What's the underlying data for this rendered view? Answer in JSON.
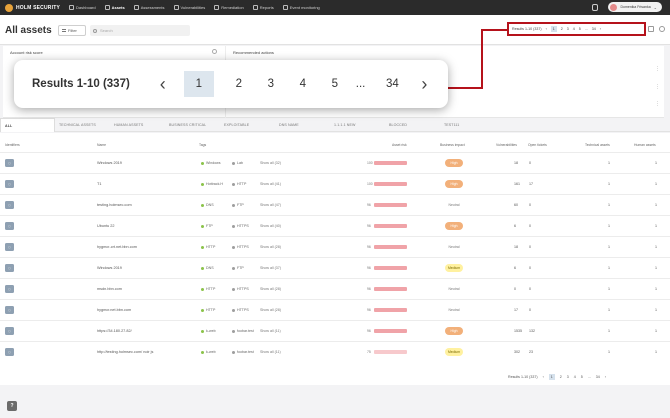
{
  "app": {
    "logo": "HOLM SECURITY",
    "user": "Domenika Frisanka"
  },
  "nav": {
    "items": [
      {
        "label": "Dashboard",
        "active": false
      },
      {
        "label": "Assets",
        "active": true
      },
      {
        "label": "Assessments",
        "active": false
      },
      {
        "label": "Vulnerabilities",
        "active": false
      },
      {
        "label": "Remediation",
        "active": false
      },
      {
        "label": "Reports",
        "active": false
      },
      {
        "label": "Event monitoring",
        "active": false
      }
    ]
  },
  "header": {
    "title": "All assets",
    "filter": "Filter",
    "search_placeholder": "Search"
  },
  "pagination": {
    "results": "Results 1-10 (337)",
    "pages": [
      "1",
      "2",
      "3",
      "4",
      "5",
      "...",
      "34"
    ],
    "prev": "‹",
    "next": "›"
  },
  "cards": {
    "left_title": "Account risk score",
    "right_title": "Recommended actions"
  },
  "tabs": [
    "ALL",
    "TECHNICAL ASSETS",
    "HUMAN ASSETS",
    "BUSINESS CRITICAL",
    "EXPLOITABLE",
    "DNS NAME",
    "1.1.1.1 NEW",
    "BLOCCED",
    "TEST111"
  ],
  "columns": [
    "Identifiers",
    "Name",
    "Tags",
    "Asset risk",
    "Business impact",
    "Vulnerabilities",
    "Open tickets",
    "Technical assets",
    "Human assets"
  ],
  "rows": [
    {
      "name": "Windows 2019",
      "tag1": "Windows",
      "tag2": "Lab",
      "more": "Show all (32)",
      "risk": "100",
      "impact": "High",
      "impact_class": "high",
      "vulns": "18",
      "tickets": "0",
      "tech": "1",
      "human": "1"
    },
    {
      "name": "T1",
      "tag1": "Hottrack.H",
      "tag2": "HTTP",
      "more": "Show all (41)",
      "risk": "100",
      "impact": "High",
      "impact_class": "high",
      "vulns": "161",
      "tickets": "17",
      "tech": "1",
      "human": "1"
    },
    {
      "name": "testing.holmsec.com",
      "tag1": "DNS",
      "tag2": "FTP",
      "more": "Show all (47)",
      "risk": "96",
      "impact": "Neutral",
      "impact_class": "neutral",
      "vulns": "60",
      "tickets": "0",
      "tech": "1",
      "human": "1"
    },
    {
      "name": "Ubuntu 22",
      "tag1": "FTP",
      "tag2": "HTTPS",
      "more": "Show all (40)",
      "risk": "96",
      "impact": "High",
      "impact_class": "high",
      "vulns": "6",
      "tickets": "0",
      "tech": "1",
      "human": "1"
    },
    {
      "name": "hygmcr-crt.net.bbn.com",
      "tag1": "HTTP",
      "tag2": "HTTPS",
      "more": "Show all (28)",
      "risk": "96",
      "impact": "Neutral",
      "impact_class": "neutral",
      "vulns": "18",
      "tickets": "0",
      "tech": "1",
      "human": "1"
    },
    {
      "name": "Windows 2019",
      "tag1": "DNS",
      "tag2": "FTP",
      "more": "Show all (37)",
      "risk": "96",
      "impact": "Medium",
      "impact_class": "medium",
      "vulns": "6",
      "tickets": "0",
      "tech": "1",
      "human": "1"
    },
    {
      "name": "msdn.bbn.com",
      "tag1": "HTTP",
      "tag2": "HTTPS",
      "more": "Show all (28)",
      "risk": "96",
      "impact": "Neutral",
      "impact_class": "neutral",
      "vulns": "0",
      "tickets": "0",
      "tech": "1",
      "human": "1"
    },
    {
      "name": "hygmcr.net.bbn.com",
      "tag1": "HTTP",
      "tag2": "HTTPS",
      "more": "Show all (28)",
      "risk": "96",
      "impact": "Neutral",
      "impact_class": "neutral",
      "vulns": "17",
      "tickets": "0",
      "tech": "1",
      "human": "1"
    },
    {
      "name": "https://34.180.27.82/",
      "tag1": "k-web",
      "tag2": "foobar.test",
      "more": "Show all (11)",
      "risk": "96",
      "impact": "High",
      "impact_class": "high",
      "vulns": "1535",
      "tickets": "132",
      "tech": "1",
      "human": "1"
    },
    {
      "name": "http://testing.holmsec.com/ noir js",
      "tag1": "k-web",
      "tag2": "foobar.test",
      "more": "Show all (11)",
      "risk": "75",
      "impact": "Medium",
      "impact_class": "medium",
      "vulns": "302",
      "tickets": "23",
      "tech": "1",
      "human": "1"
    }
  ],
  "help": "?"
}
